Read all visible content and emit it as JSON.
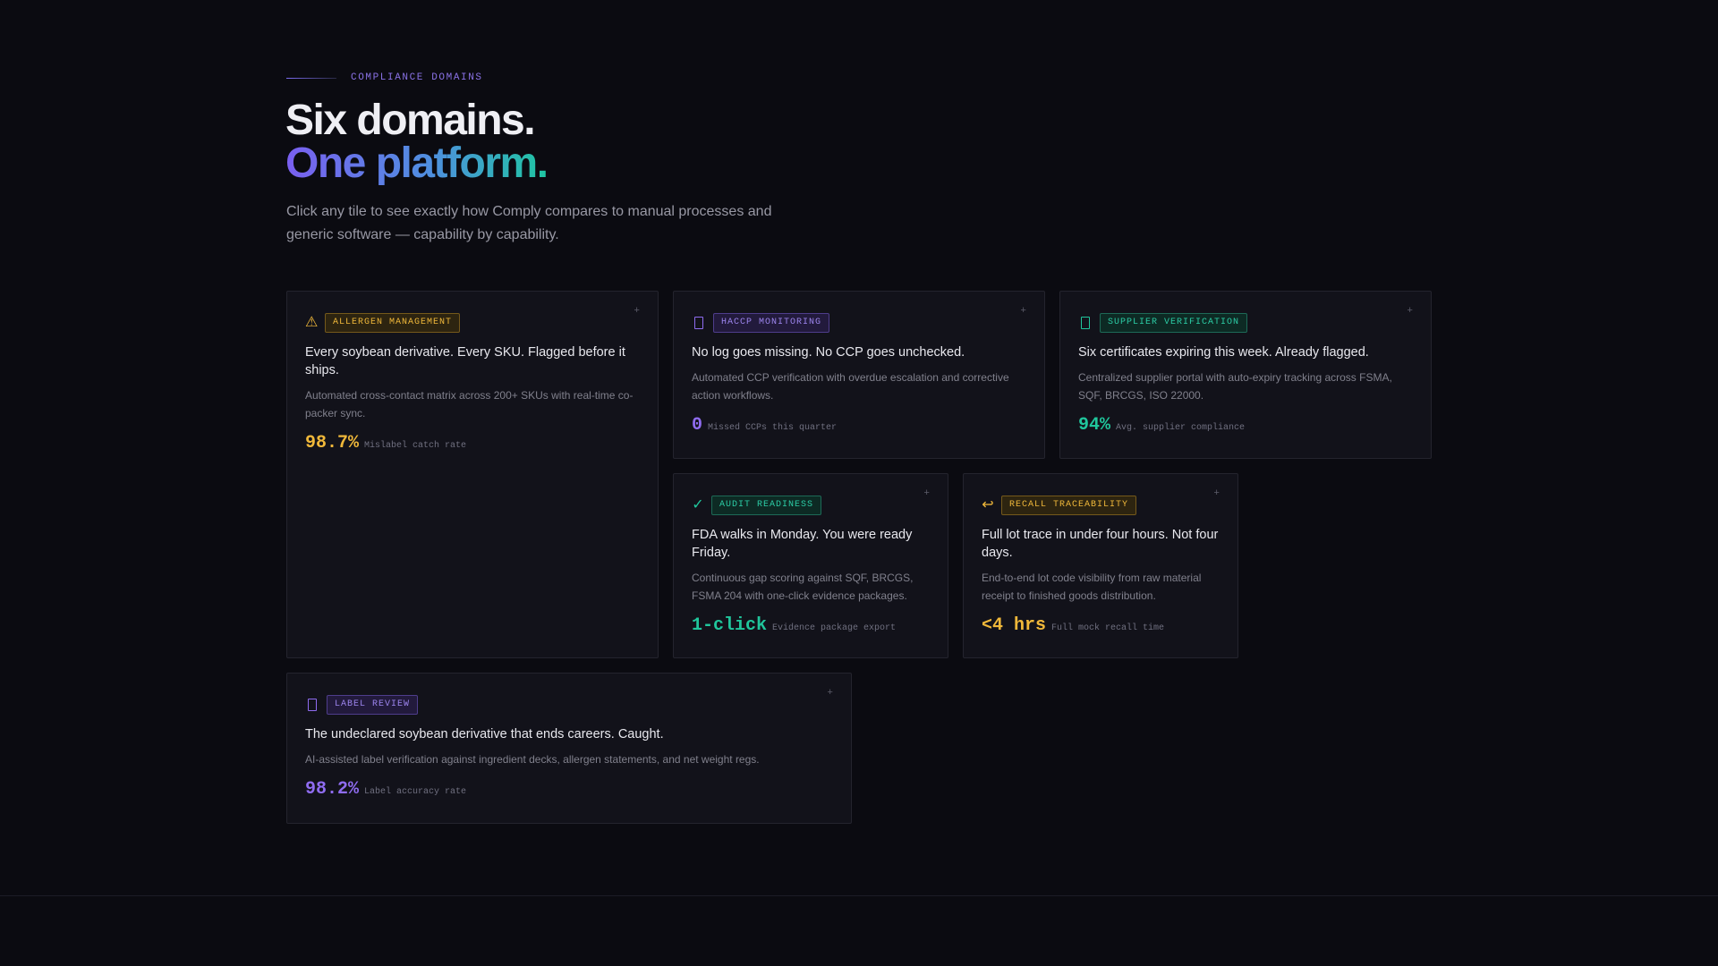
{
  "section": {
    "eyebrow": "COMPLIANCE DOMAINS",
    "title_line1": "Six domains.",
    "title_line2": "One platform.",
    "subtitle": "Click any tile to see exactly how Comply compares to manual processes and generic software — capability by capability."
  },
  "colors": {
    "amber": "#f0b83a",
    "purple": "#8f6cf0",
    "teal": "#20c69c",
    "background": "#0b0b11"
  },
  "tiles": [
    {
      "tag": "ALLERGEN MANAGEMENT",
      "icon": "warning-icon",
      "accent": "amber",
      "title": "Every soybean derivative. Every SKU. Flagged before it ships.",
      "desc": "Automated cross-contact matrix across 200+ SKUs with real-time co-packer sync.",
      "metric": "98.7%",
      "metric_label": "Mislabel catch rate",
      "expand": "+"
    },
    {
      "tag": "HACCP MONITORING",
      "icon": "clipboard-icon",
      "accent": "purple",
      "title": "No log goes missing. No CCP goes unchecked.",
      "desc": "Automated CCP verification with overdue escalation and corrective action workflows.",
      "metric": "0",
      "metric_label": "Missed CCPs this quarter",
      "expand": "+"
    },
    {
      "tag": "SUPPLIER VERIFICATION",
      "icon": "document-icon",
      "accent": "teal",
      "title": "Six certificates expiring this week. Already flagged.",
      "desc": "Centralized supplier portal with auto-expiry tracking across FSMA, SQF, BRCGS, ISO 22000.",
      "metric": "94%",
      "metric_label": "Avg. supplier compliance",
      "expand": "+"
    },
    {
      "tag": "AUDIT READINESS",
      "icon": "checkmark-icon",
      "accent": "teal",
      "title": "FDA walks in Monday. You were ready Friday.",
      "desc": "Continuous gap scoring against SQF, BRCGS, FSMA 204 with one-click evidence packages.",
      "metric": "1-click",
      "metric_label": "Evidence package export",
      "expand": "+"
    },
    {
      "tag": "RECALL TRACEABILITY",
      "icon": "return-arrow-icon",
      "accent": "amber",
      "title": "Full lot trace in under four hours. Not four days.",
      "desc": "End-to-end lot code visibility from raw material receipt to finished goods distribution.",
      "metric": "<4 hrs",
      "metric_label": "Full mock recall time",
      "expand": "+"
    },
    {
      "tag": "LABEL REVIEW",
      "icon": "label-icon",
      "accent": "purple",
      "title": "The undeclared soybean derivative that ends careers. Caught.",
      "desc": "AI-assisted label verification against ingredient decks, allergen statements, and net weight regs.",
      "metric": "98.2%",
      "metric_label": "Label accuracy rate",
      "expand": "+"
    }
  ]
}
